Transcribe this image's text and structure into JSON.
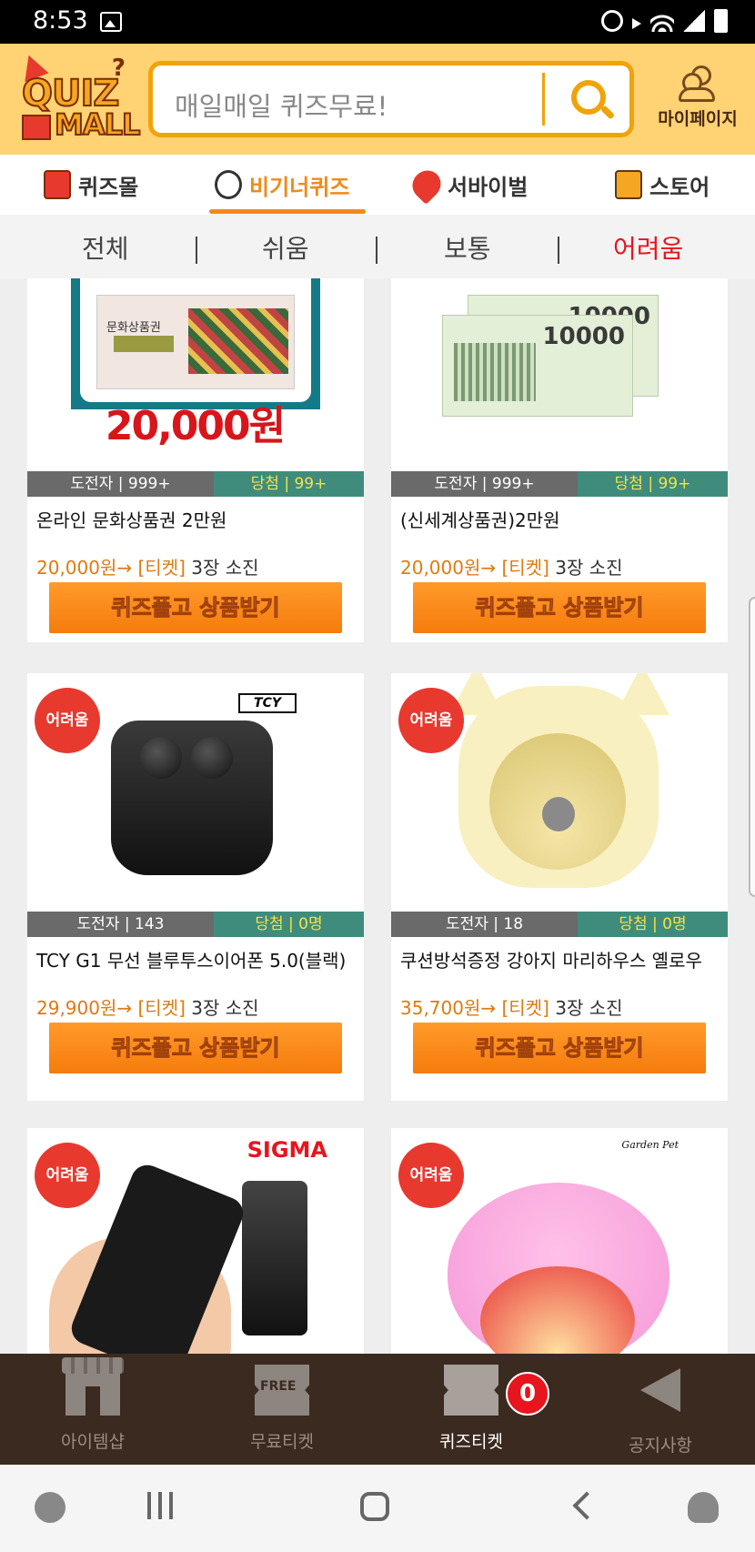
{
  "status_bar": {
    "time": "8:53"
  },
  "header": {
    "logo_text_top": "QUIZ",
    "logo_text_bottom": "MALL",
    "search_placeholder": "매일매일 퀴즈무료!",
    "mypage_label": "마이페이지"
  },
  "tabs": [
    {
      "label": "퀴즈몰",
      "icon": "gift-icon"
    },
    {
      "label": "비기너퀴즈",
      "icon": "stopwatch-icon",
      "active": true
    },
    {
      "label": "서바이벌",
      "icon": "rocket-icon"
    },
    {
      "label": "스토어",
      "icon": "calculator-icon"
    }
  ],
  "filters": [
    {
      "label": "전체"
    },
    {
      "label": "쉬움"
    },
    {
      "label": "보통"
    },
    {
      "label": "어려움",
      "selected": true
    }
  ],
  "products": [
    {
      "title": "온라인 문화상품권 2만원",
      "challengers": "도전자 | 999+",
      "winners": "당첨 | 99+",
      "price": "20,000원→ [티켓]",
      "cost": " 3장 소진",
      "button": "퀴즈풀고 상품받기",
      "image_amount": "20,000원",
      "image_label": "문화상품권"
    },
    {
      "title": "(신세계상품권)2만원",
      "challengers": "도전자 | 999+",
      "winners": "당첨 | 99+",
      "price": "20,000원→ [티켓]",
      "cost": " 3장 소진",
      "button": "퀴즈풀고 상품받기",
      "image_amount": "10000"
    },
    {
      "title": "TCY G1 무선 블루투스이어폰 5.0(블랙)",
      "challengers": "도전자 | 143",
      "winners": "당첨 | 0명",
      "price": "29,900원→ [티켓]",
      "cost": " 3장 소진",
      "button": "퀴즈풀고 상품받기",
      "badge": "어려움",
      "brand": "TCY"
    },
    {
      "title": "쿠션방석증정 강아지 마리하우스 옐로우",
      "challengers": "도전자 | 18",
      "winners": "당첨 | 0명",
      "price": "35,700원→ [티켓]",
      "cost": " 3장 소진",
      "button": "퀴즈풀고 상품받기",
      "badge": "어려움"
    },
    {
      "badge": "어려움",
      "brand": "SIGMA"
    },
    {
      "badge": "어려움",
      "brand": "Garden Pet"
    }
  ],
  "bottom_nav": [
    {
      "label": "아이템샵",
      "icon": "shop-icon"
    },
    {
      "label": "무료티켓",
      "icon": "free-ticket-icon",
      "icon_text": "FREE"
    },
    {
      "label": "퀴즈티켓",
      "icon": "quiz-ticket-icon",
      "badge": "0",
      "active": true
    },
    {
      "label": "공지사항",
      "icon": "megaphone-icon"
    }
  ]
}
